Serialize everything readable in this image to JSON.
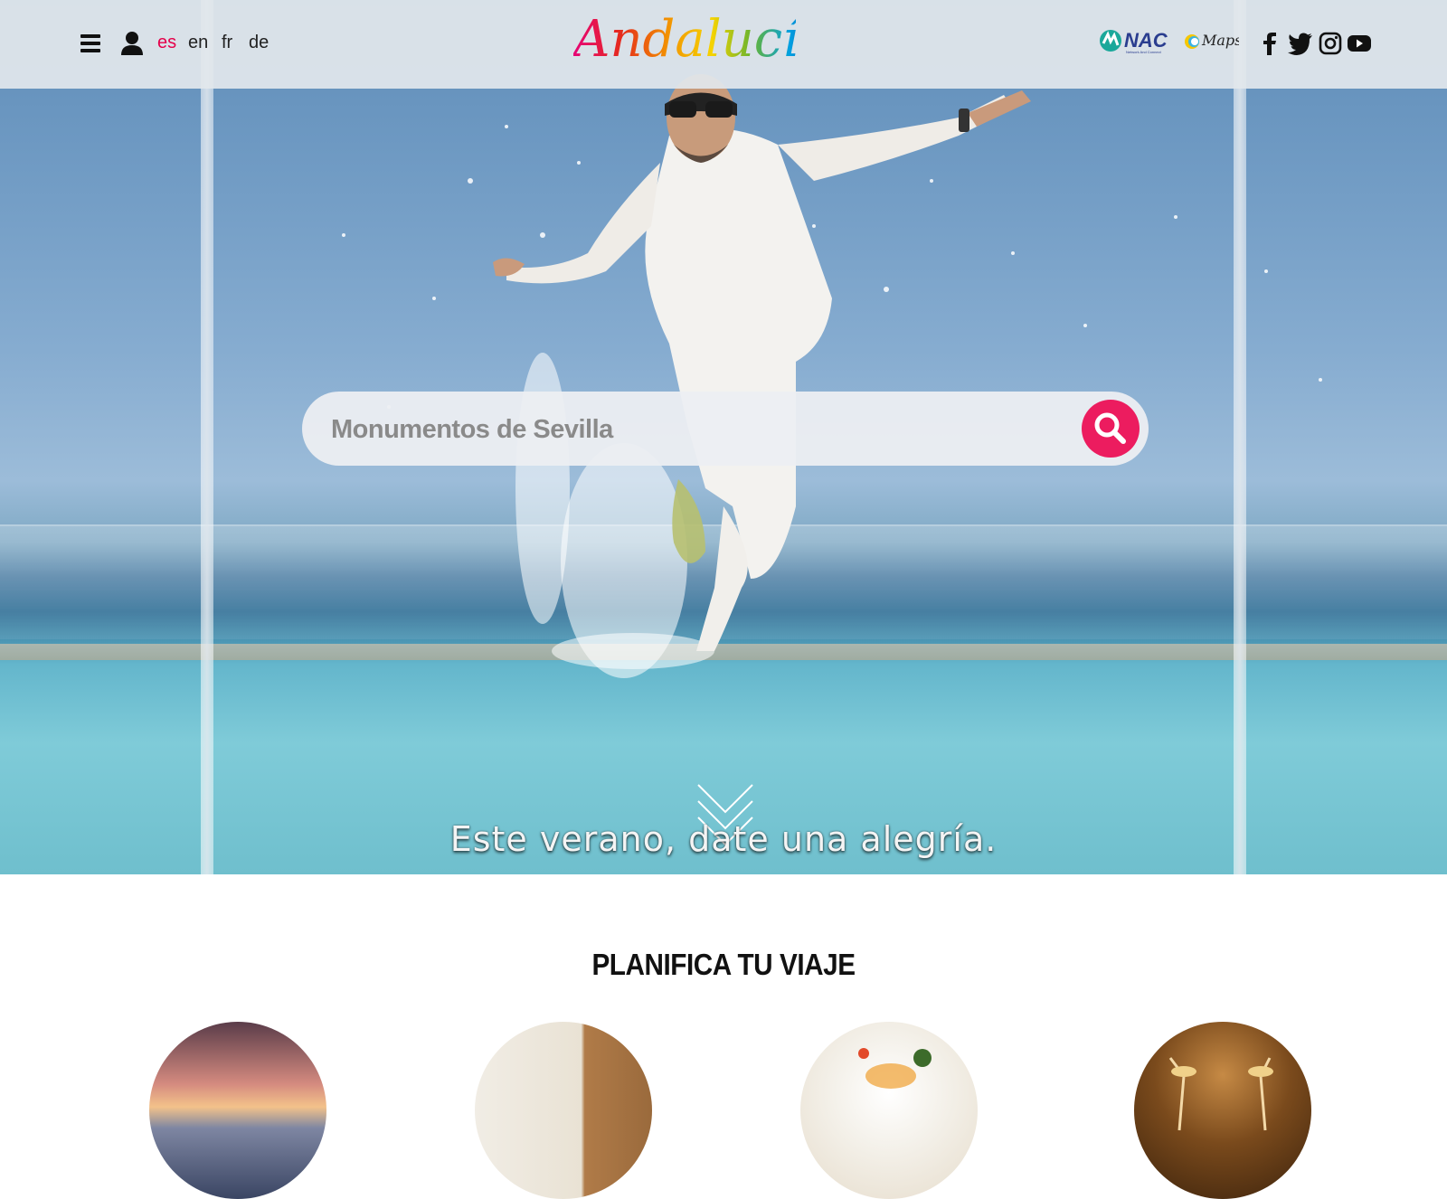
{
  "header": {
    "languages": [
      {
        "code": "es",
        "active": true
      },
      {
        "code": "en",
        "active": false
      },
      {
        "code": "fr",
        "active": false
      },
      {
        "code": "de",
        "active": false
      }
    ],
    "logo_text": "Andalucía",
    "partner_logos": {
      "nac": {
        "text": "NAC",
        "subtext": "Network And Connect"
      },
      "maps": {
        "text": "Maps"
      }
    },
    "social_icons": [
      "facebook-icon",
      "twitter-icon",
      "instagram-icon",
      "youtube-icon"
    ],
    "accent_color": "#e5004a"
  },
  "hero": {
    "search": {
      "placeholder": "Monumentos de Sevilla",
      "value": "",
      "button_color": "#ec1c5f"
    },
    "tagline": "Este verano, date una alegría."
  },
  "plan": {
    "title": "PLANIFICA TU VIAJE",
    "cards": [
      "plan-card-1",
      "plan-card-2",
      "plan-card-3",
      "plan-card-4"
    ]
  }
}
